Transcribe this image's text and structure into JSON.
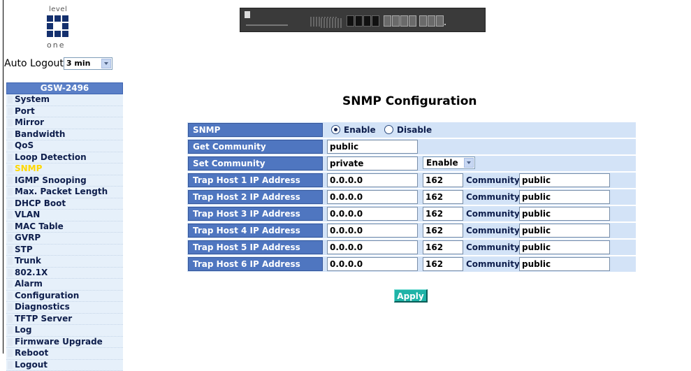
{
  "logo": {
    "top_text": "level",
    "bottom_text": "one"
  },
  "auto_logout": {
    "label": "Auto Logout",
    "value": "3 min"
  },
  "device_image": {
    "icon": "switch-front-panel-image"
  },
  "sidebar": {
    "title": "GSW-2496",
    "items": [
      {
        "label": "System"
      },
      {
        "label": "Port"
      },
      {
        "label": "Mirror"
      },
      {
        "label": "Bandwidth"
      },
      {
        "label": "QoS"
      },
      {
        "label": "Loop Detection"
      },
      {
        "label": "SNMP"
      },
      {
        "label": "IGMP Snooping"
      },
      {
        "label": "Max. Packet Length"
      },
      {
        "label": "DHCP Boot"
      },
      {
        "label": "VLAN"
      },
      {
        "label": "MAC Table"
      },
      {
        "label": "GVRP"
      },
      {
        "label": "STP"
      },
      {
        "label": "Trunk"
      },
      {
        "label": "802.1X"
      },
      {
        "label": "Alarm"
      },
      {
        "label": "Configuration"
      },
      {
        "label": "Diagnostics"
      },
      {
        "label": "TFTP Server"
      },
      {
        "label": "Log"
      },
      {
        "label": "Firmware Upgrade"
      },
      {
        "label": "Reboot"
      },
      {
        "label": "Logout"
      }
    ],
    "active_item": "SNMP"
  },
  "main": {
    "title": "SNMP Configuration",
    "snmp": {
      "label": "SNMP",
      "enable_label": "Enable",
      "disable_label": "Disable",
      "selected": "Enable"
    },
    "get_community": {
      "label": "Get Community",
      "value": "public"
    },
    "set_community": {
      "label": "Set Community",
      "value": "private",
      "state": "Enable"
    },
    "community_label": "Community",
    "trap_hosts": [
      {
        "label": "Trap Host 1 IP Address",
        "ip": "0.0.0.0",
        "port": "162",
        "community": "public"
      },
      {
        "label": "Trap Host 2 IP Address",
        "ip": "0.0.0.0",
        "port": "162",
        "community": "public"
      },
      {
        "label": "Trap Host 3 IP Address",
        "ip": "0.0.0.0",
        "port": "162",
        "community": "public"
      },
      {
        "label": "Trap Host 4 IP Address",
        "ip": "0.0.0.0",
        "port": "162",
        "community": "public"
      },
      {
        "label": "Trap Host 5 IP Address",
        "ip": "0.0.0.0",
        "port": "162",
        "community": "public"
      },
      {
        "label": "Trap Host 6 IP Address",
        "ip": "0.0.0.0",
        "port": "162",
        "community": "public"
      }
    ],
    "apply_label": "Apply"
  },
  "colors": {
    "label_bg": "#4f76c0",
    "row_bg": "#d3e3f7",
    "sidebar_bg": "#e6f0fa",
    "active_item": "#ffd800",
    "apply_bg": "#1fb3a7"
  }
}
